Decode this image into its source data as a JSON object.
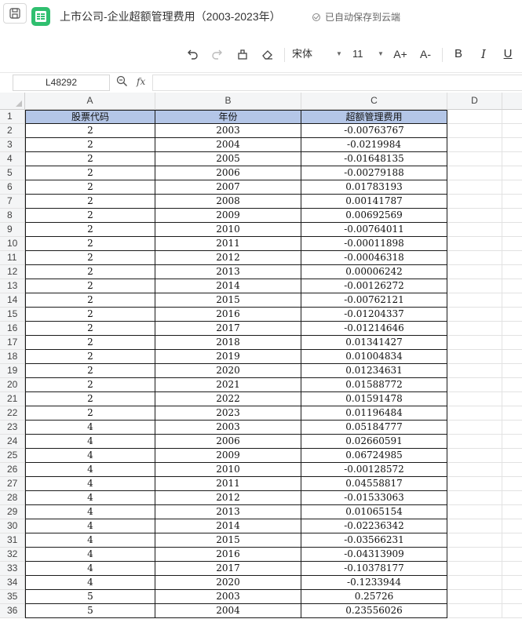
{
  "title_bar": {
    "doc_title": "上市公司-企业超额管理费用（2003-2023年）",
    "autosave_status": "已自动保存到云端"
  },
  "toolbar": {
    "font_name": "宋体",
    "font_size": "11",
    "increase_font_label": "A+",
    "decrease_font_label": "A-",
    "bold_label": "B",
    "italic_label": "I",
    "underline_label": "U",
    "icons": [
      "undo-icon",
      "redo-icon",
      "format-painter-icon",
      "eraser-icon",
      "dropdown-icon",
      "bold-icon",
      "italic-icon",
      "underline-icon"
    ]
  },
  "formula_bar": {
    "cell_ref": "L48292",
    "fx_label": "fx",
    "value": ""
  },
  "sheet": {
    "columns": [
      "A",
      "B",
      "C",
      "D"
    ],
    "header_fill": "#b4c6e7",
    "header_row": {
      "row": "1",
      "a": "股票代码",
      "b": "年份",
      "c": "超额管理费用"
    },
    "rows": [
      {
        "row": "2",
        "a": "2",
        "b": "2003",
        "c": "-0.00763767"
      },
      {
        "row": "3",
        "a": "2",
        "b": "2004",
        "c": "-0.0219984"
      },
      {
        "row": "4",
        "a": "2",
        "b": "2005",
        "c": "-0.01648135"
      },
      {
        "row": "5",
        "a": "2",
        "b": "2006",
        "c": "-0.00279188"
      },
      {
        "row": "6",
        "a": "2",
        "b": "2007",
        "c": "0.01783193"
      },
      {
        "row": "7",
        "a": "2",
        "b": "2008",
        "c": "0.00141787"
      },
      {
        "row": "8",
        "a": "2",
        "b": "2009",
        "c": "0.00692569"
      },
      {
        "row": "9",
        "a": "2",
        "b": "2010",
        "c": "-0.00764011"
      },
      {
        "row": "10",
        "a": "2",
        "b": "2011",
        "c": "-0.00011898"
      },
      {
        "row": "11",
        "a": "2",
        "b": "2012",
        "c": "-0.00046318"
      },
      {
        "row": "12",
        "a": "2",
        "b": "2013",
        "c": "0.00006242"
      },
      {
        "row": "13",
        "a": "2",
        "b": "2014",
        "c": "-0.00126272"
      },
      {
        "row": "14",
        "a": "2",
        "b": "2015",
        "c": "-0.00762121"
      },
      {
        "row": "15",
        "a": "2",
        "b": "2016",
        "c": "-0.01204337"
      },
      {
        "row": "16",
        "a": "2",
        "b": "2017",
        "c": "-0.01214646"
      },
      {
        "row": "17",
        "a": "2",
        "b": "2018",
        "c": "0.01341427"
      },
      {
        "row": "18",
        "a": "2",
        "b": "2019",
        "c": "0.01004834"
      },
      {
        "row": "19",
        "a": "2",
        "b": "2020",
        "c": "0.01234631"
      },
      {
        "row": "20",
        "a": "2",
        "b": "2021",
        "c": "0.01588772"
      },
      {
        "row": "21",
        "a": "2",
        "b": "2022",
        "c": "0.01591478"
      },
      {
        "row": "22",
        "a": "2",
        "b": "2023",
        "c": "0.01196484"
      },
      {
        "row": "23",
        "a": "4",
        "b": "2003",
        "c": "0.05184777"
      },
      {
        "row": "24",
        "a": "4",
        "b": "2006",
        "c": "0.02660591"
      },
      {
        "row": "25",
        "a": "4",
        "b": "2009",
        "c": "0.06724985"
      },
      {
        "row": "26",
        "a": "4",
        "b": "2010",
        "c": "-0.00128572"
      },
      {
        "row": "27",
        "a": "4",
        "b": "2011",
        "c": "0.04558817"
      },
      {
        "row": "28",
        "a": "4",
        "b": "2012",
        "c": "-0.01533063"
      },
      {
        "row": "29",
        "a": "4",
        "b": "2013",
        "c": "0.01065154"
      },
      {
        "row": "30",
        "a": "4",
        "b": "2014",
        "c": "-0.02236342"
      },
      {
        "row": "31",
        "a": "4",
        "b": "2015",
        "c": "-0.03566231"
      },
      {
        "row": "32",
        "a": "4",
        "b": "2016",
        "c": "-0.04313909"
      },
      {
        "row": "33",
        "a": "4",
        "b": "2017",
        "c": "-0.10378177"
      },
      {
        "row": "34",
        "a": "4",
        "b": "2020",
        "c": "-0.1233944"
      },
      {
        "row": "35",
        "a": "5",
        "b": "2003",
        "c": "0.25726"
      },
      {
        "row": "36",
        "a": "5",
        "b": "2004",
        "c": "0.23556026"
      }
    ]
  }
}
